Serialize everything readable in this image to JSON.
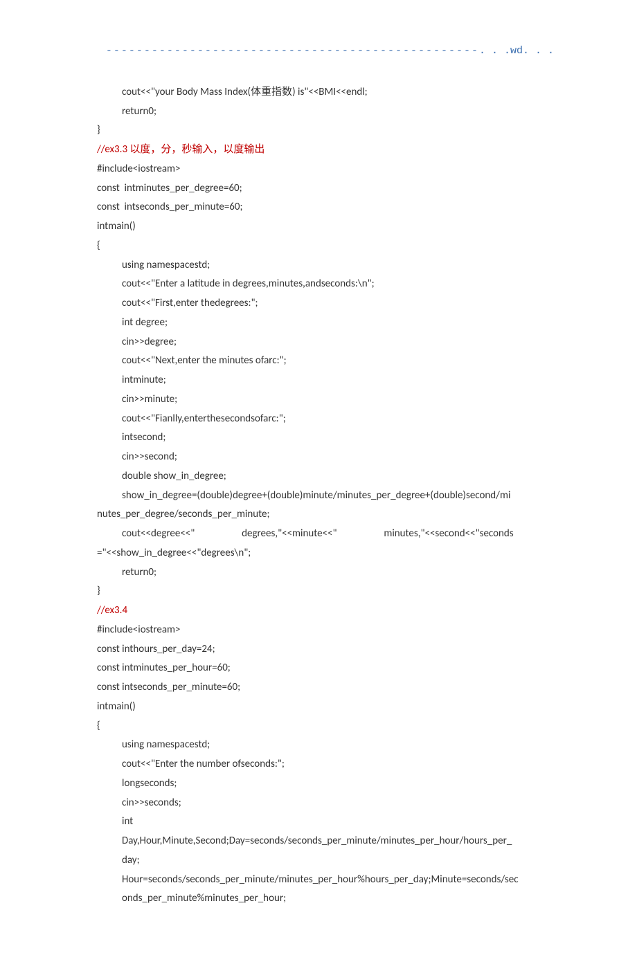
{
  "header": {
    "dashes": "-------------------------------------------------",
    "wd": ". . .wd. . ."
  },
  "lines": {
    "l01": "cout<<\"your Body Mass Index(体重指数) is\"<<BMI<<endl;",
    "l02": "return0;",
    "l03": "}",
    "l04": "//ex3.3 以度，分，秒输入，以度输出",
    "l05": "#include<iostream>",
    "l06": "const  intminutes_per_degree=60;",
    "l07": "const  intseconds_per_minute=60;",
    "l08": "intmain()",
    "l09": "{",
    "l10": "using namespacestd;",
    "l11": "cout<<\"Enter a latitude in degrees,minutes,andseconds:\\n\";",
    "l12": "cout<<\"First,enter thedegrees:\";",
    "l13": "int degree;",
    "l14": "cin>>degree;",
    "l15": "cout<<\"Next,enter the minutes ofarc:\";",
    "l16": "intminute;",
    "l17": "cin>>minute;",
    "l18": "cout<<\"Fianlly,enterthesecondsofarc:\";",
    "l19": "intsecond;",
    "l20": "cin>>second;",
    "l21": "double show_in_degree;",
    "l22a": "show_in_degree=(double)degree+(double)minute/minutes_per_degree+(double)second/mi",
    "l22b": "nutes_per_degree/seconds_per_minute;",
    "l23a": "cout<<degree<<\"                    degrees,\"<<minute<<\"                    minutes,\"<<second<<\"seconds",
    "l23b": "=\"<<show_in_degree<<\"degrees\\n\";",
    "l24": "return0;",
    "l25": "}",
    "l26": "//ex3.4",
    "l27": "#include<iostream>",
    "l28": "const inthours_per_day=24;",
    "l29": "const intminutes_per_hour=60;",
    "l30": "const intseconds_per_minute=60;",
    "l31": "intmain()",
    "l32": "{",
    "l33": "using namespacestd;",
    "l34": "cout<<\"Enter the number ofseconds:\";",
    "l35": "longseconds;",
    "l36": "cin>>seconds;",
    "l37": "int",
    "l38a": "Day,Hour,Minute,Second;Day=seconds/seconds_per_minute/minutes_per_hour/hours_per_",
    "l38b": "day;",
    "l39a": "Hour=seconds/seconds_per_minute/minutes_per_hour%hours_per_day;Minute=seconds/sec",
    "l39b": "onds_per_minute%minutes_per_hour;"
  }
}
